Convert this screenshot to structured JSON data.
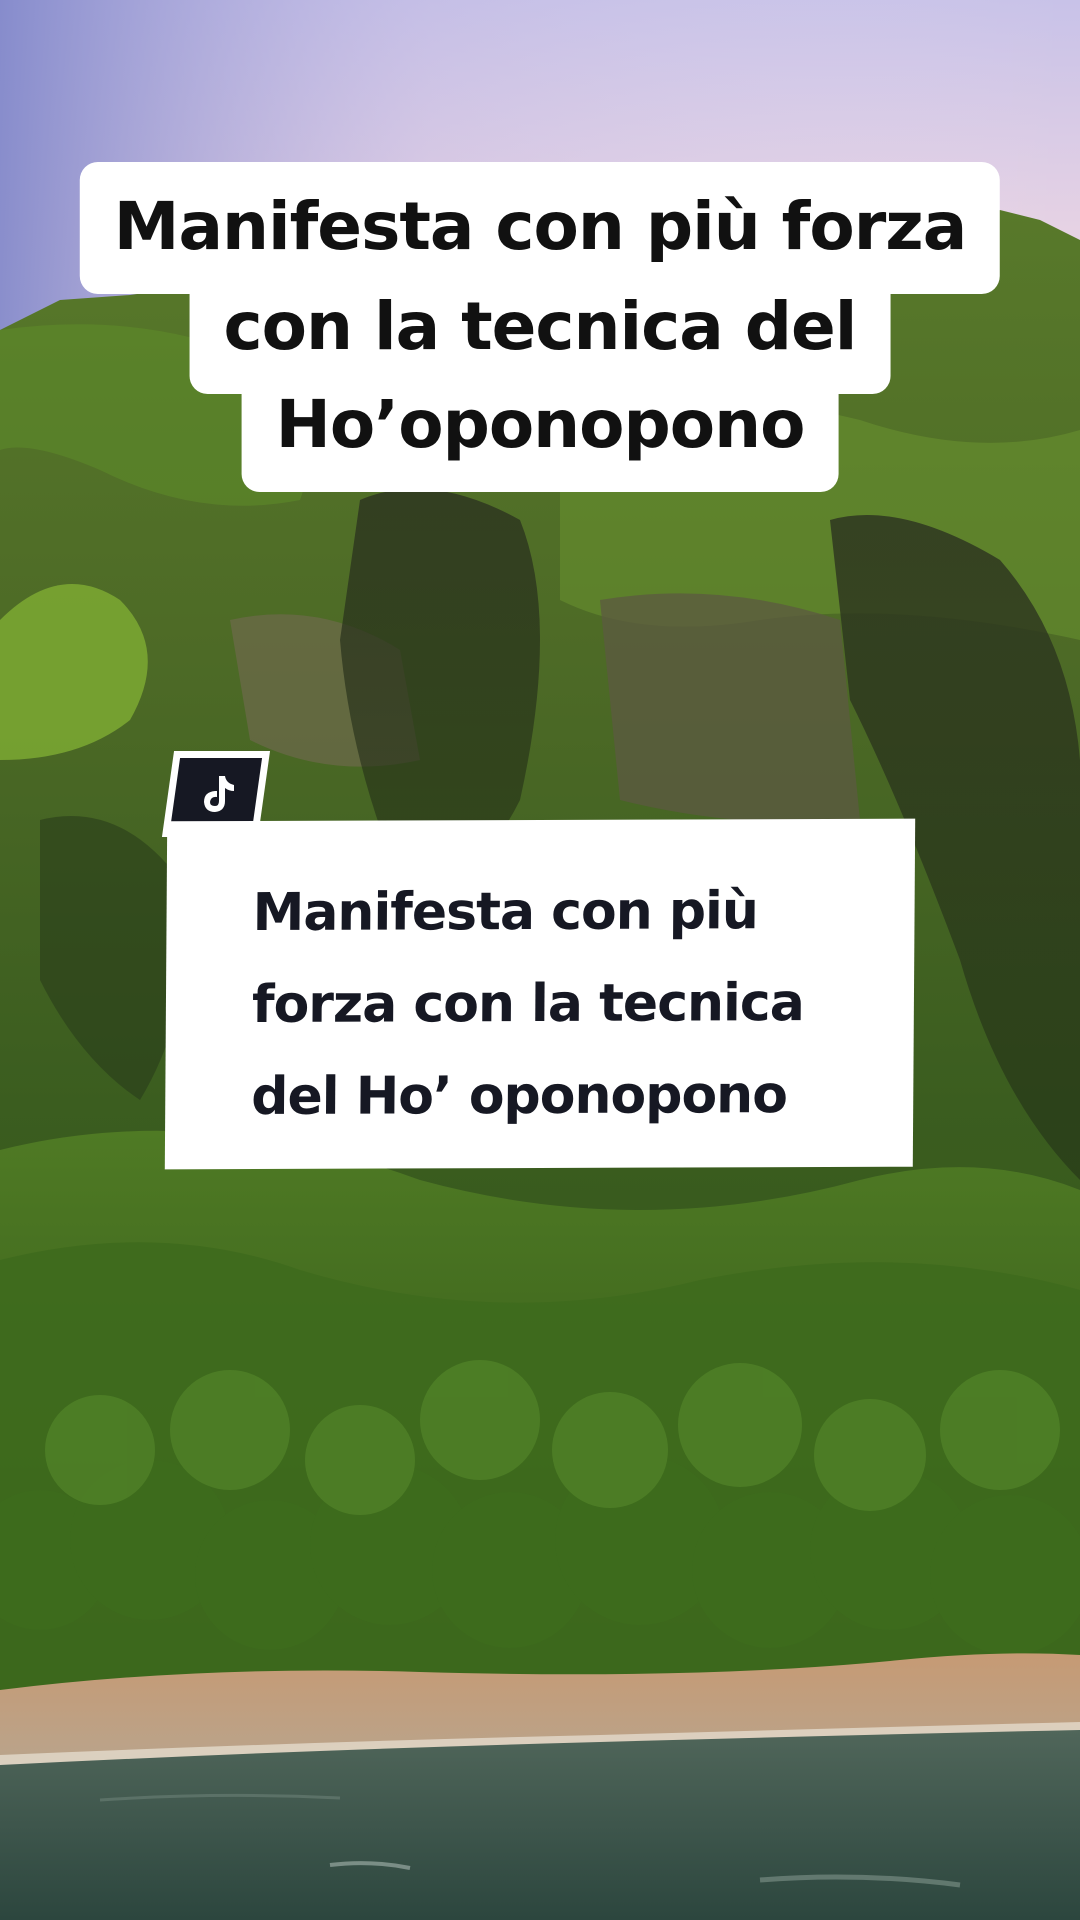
{
  "top_caption": {
    "lines": [
      "Manifesta con più forza",
      "con la tecnica del",
      "Ho’oponopono"
    ]
  },
  "tiktok_card": {
    "lines": [
      "Manifesta con più",
      "forza con la tecnica",
      "del Ho’ oponopono"
    ],
    "badge_icon": "tiktok-logo-icon"
  },
  "colors": {
    "sky_top": "#c9c3e6",
    "sky_bottom": "#e9d4e0",
    "foliage_dark": "#2f5a1e",
    "foliage_light": "#6e9a2c",
    "cliff": "#5a5a3e",
    "sand": "#c9a27e",
    "sea": "#3f5b52",
    "card_text": "#161823"
  }
}
